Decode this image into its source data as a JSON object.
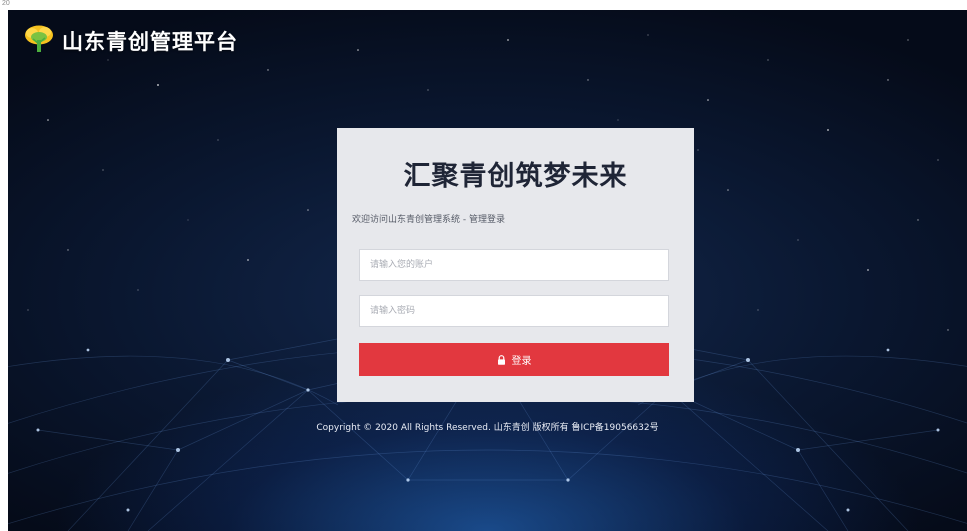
{
  "page_number": "20",
  "brand": {
    "title": "山东青创管理平台",
    "logo_icon": "tree-logo-icon"
  },
  "login": {
    "title": "汇聚青创筑梦未来",
    "subtitle": "欢迎访问山东青创管理系统 - 管理登录",
    "account_placeholder": "请输入您的账户",
    "password_placeholder": "请输入密码",
    "button_label": "登录",
    "button_icon": "lock-icon"
  },
  "footer": {
    "copyright": "Copyright © 2020 All Rights Reserved. 山东青创 版权所有 鲁ICP备19056632号"
  },
  "colors": {
    "background": "#0a1730",
    "card": "#e7e8ec",
    "accent": "#e2383f",
    "title": "#1f2536"
  }
}
